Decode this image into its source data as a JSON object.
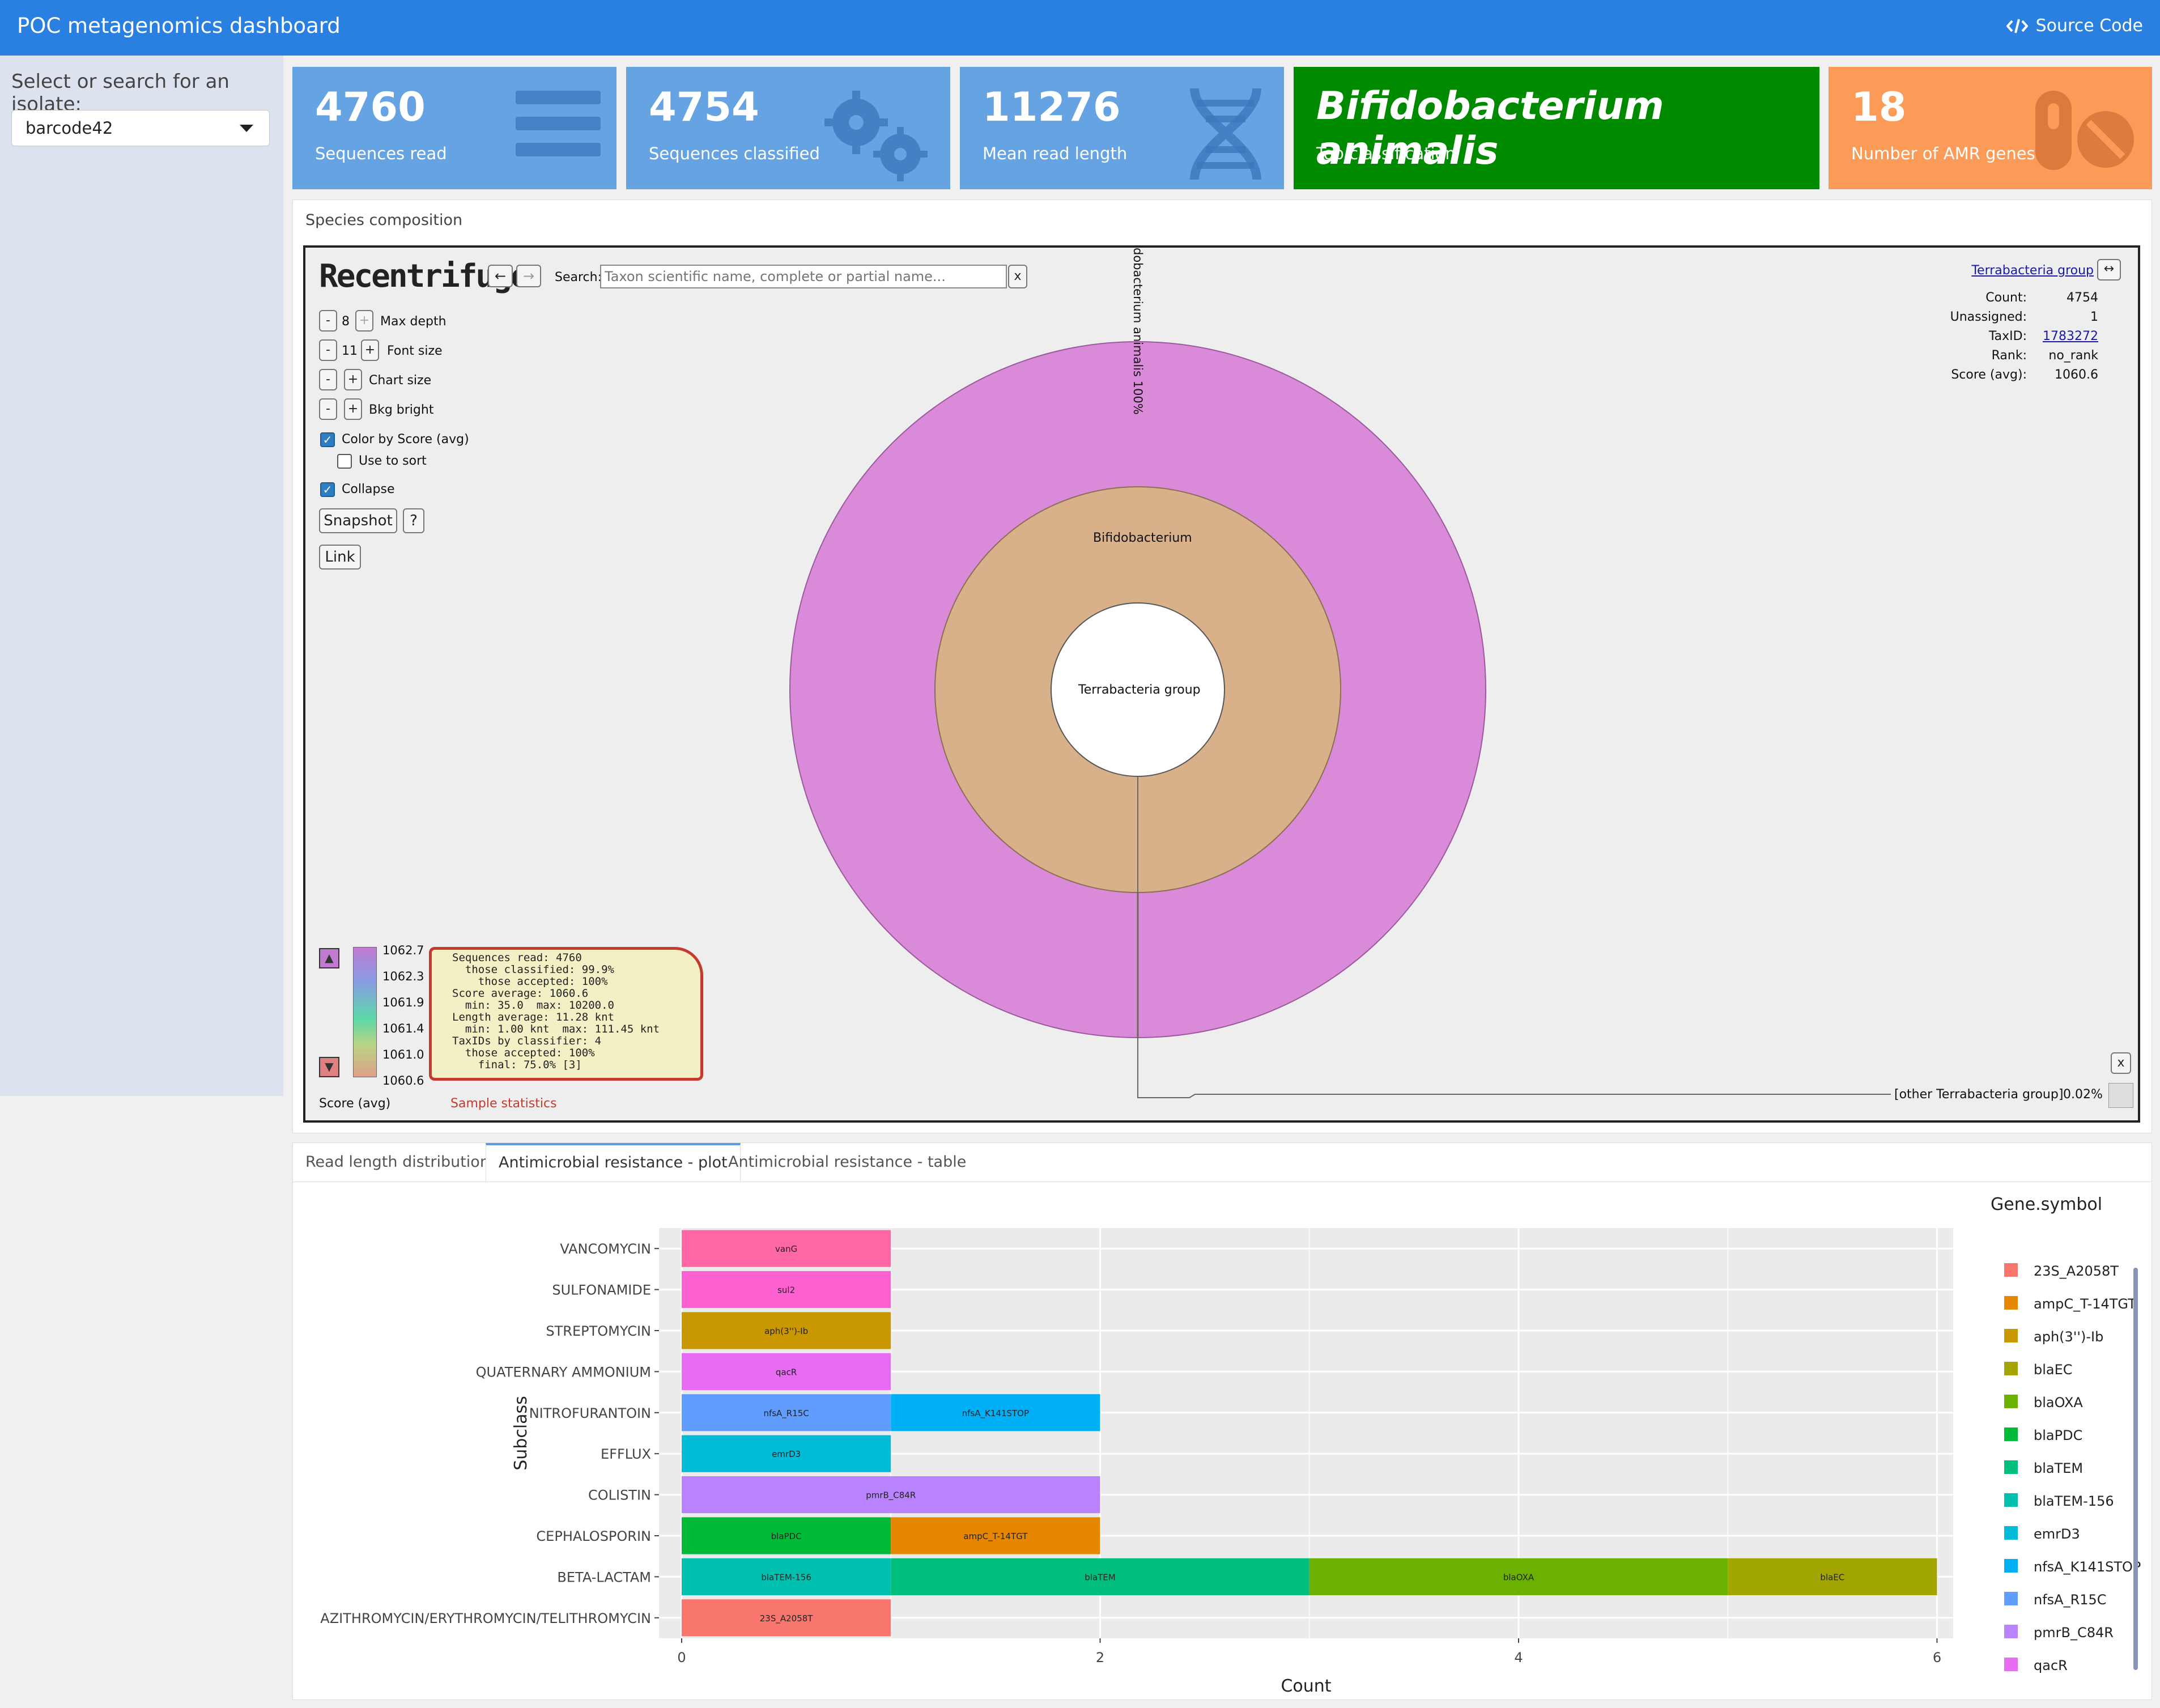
{
  "header": {
    "title": "POC metagenomics dashboard",
    "source_code": "Source Code"
  },
  "sidebar": {
    "label": "Select or search for an isolate:",
    "selected": "barcode42"
  },
  "value_boxes": [
    {
      "value": "4760",
      "label": "Sequences read",
      "color": "#66a3e2",
      "icon": "list-icon"
    },
    {
      "value": "4754",
      "label": "Sequences classified",
      "color": "#66a3e2",
      "icon": "gears-icon"
    },
    {
      "value": "11276",
      "label": "Mean read length",
      "color": "#66a3e2",
      "icon": "dna-icon"
    },
    {
      "value": "Bifidobacterium animalis",
      "label": "Top classification",
      "color": "#008a00",
      "icon": ""
    },
    {
      "value": "18",
      "label": "Number of AMR genes",
      "color": "#fc9a58",
      "icon": "pills-icon"
    }
  ],
  "species": {
    "title": "Species composition",
    "krona": {
      "logo": "Recentrifuge",
      "search_label": "Search:",
      "search_placeholder": "Taxon scientific name, complete or partial name...",
      "clear": "x",
      "max_depth": "8",
      "max_depth_label": "Max depth",
      "font_size": "11",
      "font_size_label": "Font size",
      "chart_size_label": "Chart size",
      "bkg_label": "Bkg bright",
      "color_by_label": "Color by Score (avg)",
      "use_sort_label": "Use to sort",
      "collapse_label": "Collapse",
      "snapshot": "Snapshot",
      "help": "?",
      "link": "Link",
      "minus": "-",
      "plus": "+",
      "ring_outer": "dobacterium animalis  100%",
      "ring_middle": "Bifidobacterium",
      "ring_center": "Terrabacteria group",
      "other_label": "[other Terrabacteria group]",
      "other_pct": "0.02%",
      "close": "x",
      "details": {
        "name": "Terrabacteria group",
        "count_label": "Count:",
        "count": "4754",
        "unassigned_label": "Unassigned:",
        "unassigned": "1",
        "taxid_label": "TaxID:",
        "taxid": "1783272",
        "rank_label": "Rank:",
        "rank": "no_rank",
        "score_label": "Score (avg):",
        "score": "1060.6"
      },
      "scale_values": [
        "1062.7",
        "1062.3",
        "1061.9",
        "1061.4",
        "1061.0",
        "1060.6"
      ],
      "scale_label": "Score (avg)",
      "stats_label": "Sample statistics",
      "stats": [
        "Sequences read: 4760",
        "  those classified: 99.9%",
        "    those accepted: 100%",
        "Score average: 1060.6",
        "  min: 35.0  max: 10200.0",
        "Length average: 11.28 knt",
        "  min: 1.00 knt  max: 111.45 knt",
        "TaxIDs by classifier: 4",
        "  those accepted: 100%",
        "    final: 75.0% [3]"
      ]
    }
  },
  "tabs": [
    "Read length distribution",
    "Antimicrobial resistance - plot",
    "Antimicrobial resistance - table"
  ],
  "chart_data": {
    "type": "bar",
    "orientation": "horizontal",
    "stacked": true,
    "xlabel": "Count",
    "ylabel": "Subclass",
    "xlim": [
      0,
      6
    ],
    "xticks": [
      0,
      2,
      4,
      6
    ],
    "grid": true,
    "legend_title": "Gene.symbol",
    "legend_placement": "right",
    "categories": [
      "VANCOMYCIN",
      "SULFONAMIDE",
      "STREPTOMYCIN",
      "QUATERNARY AMMONIUM",
      "NITROFURANTOIN",
      "EFFLUX",
      "COLISTIN",
      "CEPHALOSPORIN",
      "BETA-LACTAM",
      "AZITHROMYCIN/ERYTHROMYCIN/TELITHROMYCIN"
    ],
    "bars": [
      {
        "category": "VANCOMYCIN",
        "segments": [
          {
            "gene": "vanG",
            "value": 1
          }
        ]
      },
      {
        "category": "SULFONAMIDE",
        "segments": [
          {
            "gene": "sul2",
            "value": 1
          }
        ]
      },
      {
        "category": "STREPTOMYCIN",
        "segments": [
          {
            "gene": "aph(3'')-Ib",
            "value": 1
          }
        ]
      },
      {
        "category": "QUATERNARY AMMONIUM",
        "segments": [
          {
            "gene": "qacR",
            "value": 1
          }
        ]
      },
      {
        "category": "NITROFURANTOIN",
        "segments": [
          {
            "gene": "nfsA_R15C",
            "value": 1
          },
          {
            "gene": "nfsA_K141STOP",
            "value": 1
          }
        ]
      },
      {
        "category": "EFFLUX",
        "segments": [
          {
            "gene": "emrD3",
            "value": 1
          }
        ]
      },
      {
        "category": "COLISTIN",
        "segments": [
          {
            "gene": "pmrB_C84R",
            "value": 2
          }
        ]
      },
      {
        "category": "CEPHALOSPORIN",
        "segments": [
          {
            "gene": "blaPDC",
            "value": 1
          },
          {
            "gene": "ampC_T-14TGT",
            "value": 1
          }
        ]
      },
      {
        "category": "BETA-LACTAM",
        "segments": [
          {
            "gene": "blaTEM-156",
            "value": 1
          },
          {
            "gene": "blaTEM",
            "value": 2
          },
          {
            "gene": "blaOXA",
            "value": 2
          },
          {
            "gene": "blaEC",
            "value": 1
          }
        ]
      },
      {
        "category": "AZITHROMYCIN/ERYTHROMYCIN/TELITHROMYCIN",
        "segments": [
          {
            "gene": "23S_A2058T",
            "value": 1
          }
        ]
      }
    ],
    "legend": [
      {
        "gene": "23S_A2058T",
        "color": "#F8766D"
      },
      {
        "gene": "ampC_T-14TGT",
        "color": "#E58700"
      },
      {
        "gene": "aph(3'')-Ib",
        "color": "#C99800"
      },
      {
        "gene": "blaEC",
        "color": "#A3A500"
      },
      {
        "gene": "blaOXA",
        "color": "#6BB100"
      },
      {
        "gene": "blaPDC",
        "color": "#00BA38"
      },
      {
        "gene": "blaTEM",
        "color": "#00BF7D"
      },
      {
        "gene": "blaTEM-156",
        "color": "#00C0AF"
      },
      {
        "gene": "emrD3",
        "color": "#00BCD8"
      },
      {
        "gene": "nfsA_K141STOP",
        "color": "#00B0F6"
      },
      {
        "gene": "nfsA_R15C",
        "color": "#619CFF"
      },
      {
        "gene": "pmrB_C84R",
        "color": "#B983FF"
      },
      {
        "gene": "qacR",
        "color": "#E76BF3"
      },
      {
        "gene": "sul2",
        "color": "#FD61D1"
      },
      {
        "gene": "vanG",
        "color": "#FF67A4"
      }
    ]
  }
}
